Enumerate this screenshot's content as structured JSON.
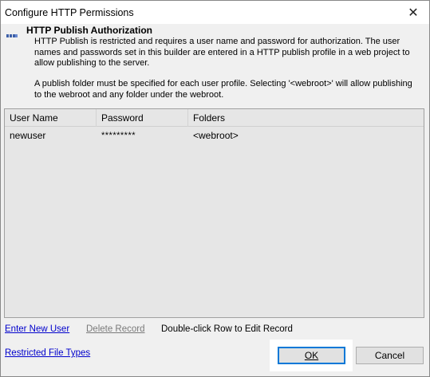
{
  "window": {
    "title": "Configure HTTP Permissions",
    "close_glyph": "✕"
  },
  "header": {
    "icon": "users-icon",
    "title": "HTTP Publish Authorization",
    "description_1": "HTTP Publish is restricted and requires a user name and password for authorization.  The user names and passwords set in this builder are entered in a HTTP publish profile in a web project to allow publishing to the server.",
    "description_2": "A publish folder must be specified for each user profile.  Selecting '<webroot>' will allow publishing to the webroot and any folder under the webroot."
  },
  "grid": {
    "columns": [
      "User Name",
      "Password",
      "Folders"
    ],
    "rows": [
      {
        "user_name": "newuser",
        "password": "*********",
        "folders": "<webroot>"
      }
    ]
  },
  "actions": {
    "enter_new_user": "Enter New User",
    "delete_record": "Delete Record",
    "hint": "Double-click Row to Edit Record",
    "restricted_file_types": "Restricted File Types"
  },
  "buttons": {
    "ok": "OK",
    "cancel": "Cancel"
  },
  "colors": {
    "link": "#0000cc",
    "focus_border": "#0078d7",
    "grid_bg": "#e6e6e6"
  }
}
